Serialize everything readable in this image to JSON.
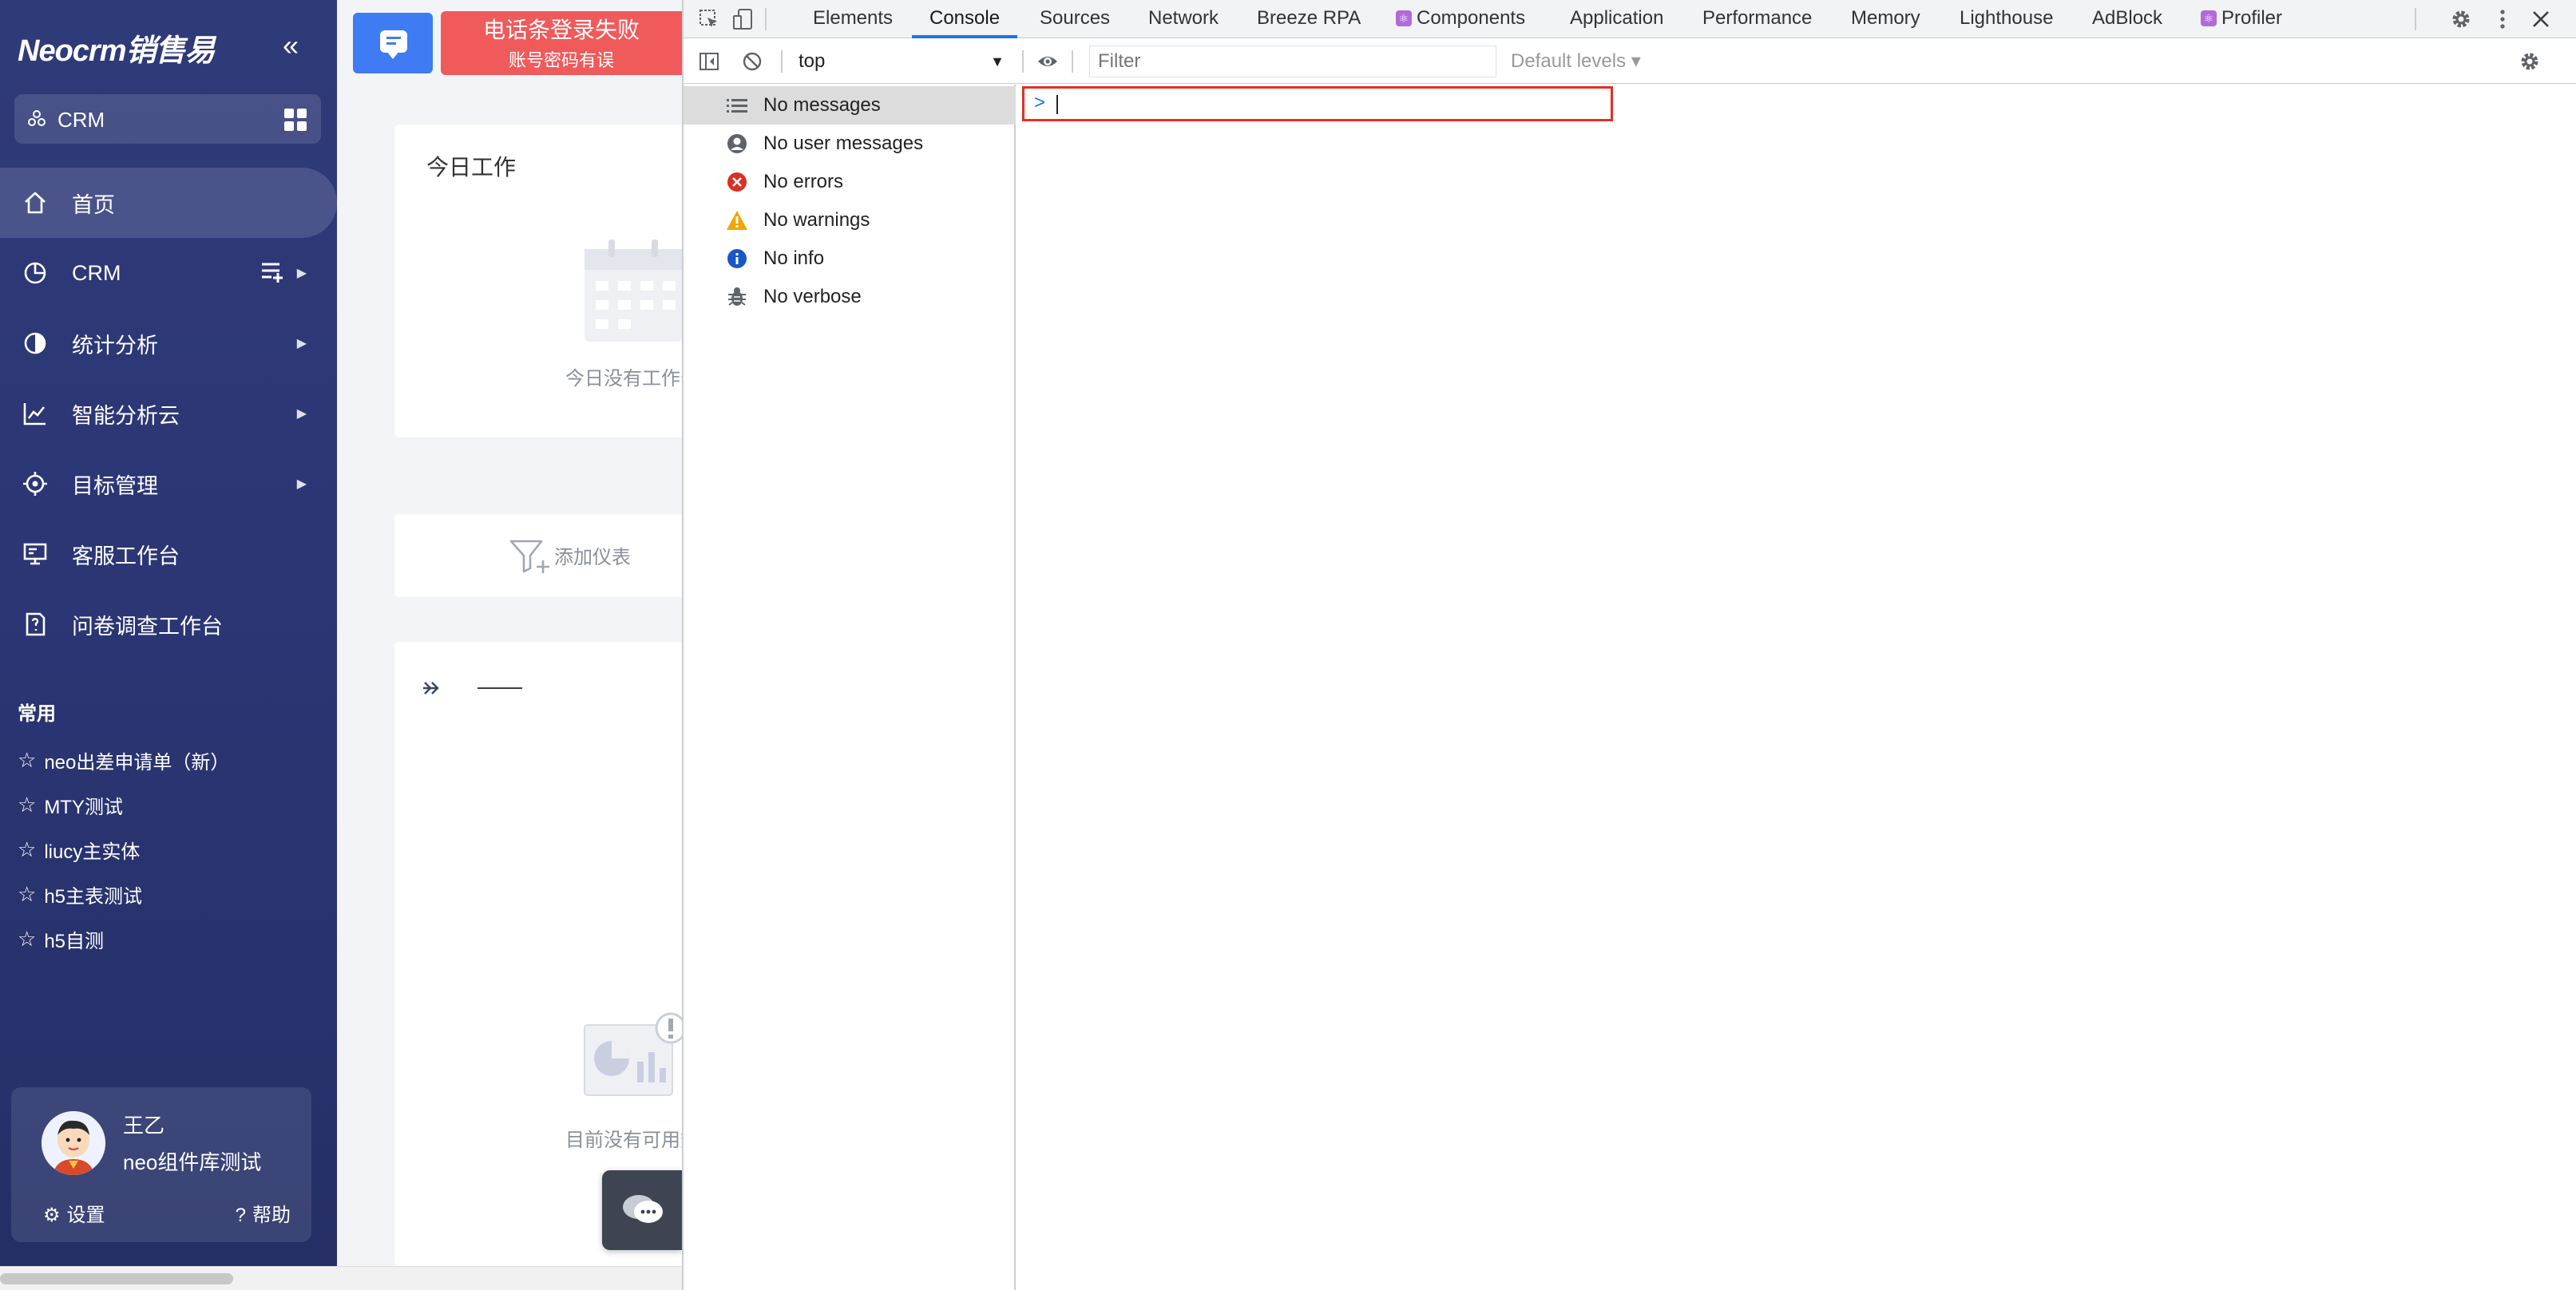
{
  "app": {
    "logo": "Neocrm销售易",
    "collapse_icon": "«",
    "module_label": "CRM"
  },
  "sidebar": {
    "menu": [
      {
        "label": "首页",
        "icon": "home-icon",
        "active": true
      },
      {
        "label": "CRM",
        "icon": "pie-icon",
        "has_arrow": true,
        "has_list_icon": true
      },
      {
        "label": "统计分析",
        "icon": "half-circle-icon",
        "has_arrow": true
      },
      {
        "label": "智能分析云",
        "icon": "line-chart-icon",
        "has_arrow": true
      },
      {
        "label": "目标管理",
        "icon": "target-icon",
        "has_arrow": true
      },
      {
        "label": "客服工作台",
        "icon": "monitor-icon"
      },
      {
        "label": "问卷调查工作台",
        "icon": "survey-icon"
      }
    ],
    "favorites_title": "常用",
    "favorites": [
      "neo出差申请单（新）",
      "MTY测试",
      "liucy主实体",
      "h5主表测试",
      "h5自测"
    ],
    "user": {
      "name": "王乙",
      "org": "neo组件库测试",
      "settings_label": "设置",
      "help_label": "帮助"
    }
  },
  "page": {
    "alert_line1": "电话条登录失败",
    "alert_line2": "账号密码有误",
    "today_title": "今日工作",
    "today_empty": "今日没有工作安",
    "add_dashboard": "添加仪表",
    "section_dash": "——",
    "no_data": "目前没有可用数"
  },
  "devtools": {
    "tabs": [
      "Elements",
      "Console",
      "Sources",
      "Network",
      "Breeze RPA",
      "Components",
      "Application",
      "Performance",
      "Memory",
      "Lighthouse",
      "AdBlock",
      "Profiler"
    ],
    "active_tab": "Console",
    "context": "top",
    "filter_placeholder": "Filter",
    "levels": "Default levels ▾",
    "sidebar": [
      {
        "label": "No messages",
        "icon": "list-icon",
        "selected": true
      },
      {
        "label": "No user messages",
        "icon": "user-icon"
      },
      {
        "label": "No errors",
        "icon": "error-icon"
      },
      {
        "label": "No warnings",
        "icon": "warning-icon"
      },
      {
        "label": "No info",
        "icon": "info-icon"
      },
      {
        "label": "No verbose",
        "icon": "bug-icon"
      }
    ],
    "prompt_symbol": ">"
  }
}
